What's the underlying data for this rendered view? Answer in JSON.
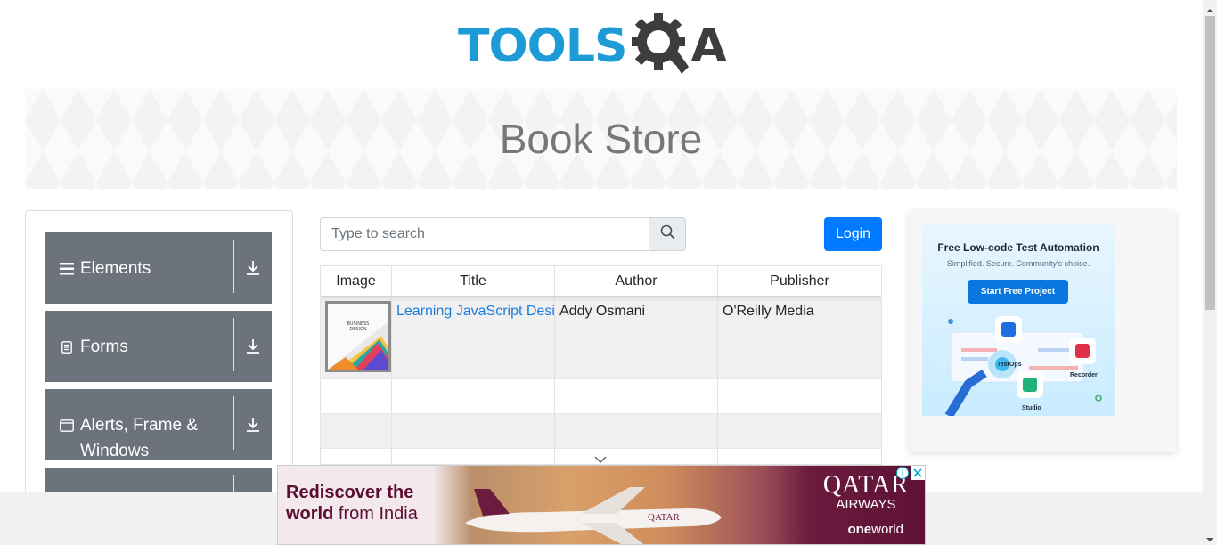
{
  "header": {
    "logo_text": "TOOLS",
    "logo_suffix": "A",
    "logo_color": "#1c9bd7"
  },
  "banner": {
    "title": "Book Store"
  },
  "sidebar": {
    "groups": [
      {
        "label": "Elements",
        "icon": "hamburger-icon"
      },
      {
        "label": "Forms",
        "icon": "document-icon"
      },
      {
        "label": "Alerts, Frame & Windows",
        "icon": "window-icon"
      },
      {
        "label": "",
        "icon": ""
      }
    ]
  },
  "search": {
    "placeholder": "Type to search",
    "value": ""
  },
  "login": {
    "label": "Login",
    "color": "#007bff"
  },
  "table": {
    "columns": [
      "Image",
      "Title",
      "Author",
      "Publisher"
    ],
    "rows": [
      {
        "title": "Learning JavaScript Design Patterns",
        "author": "Addy Osmani",
        "publisher": "O'Reilly Media"
      }
    ]
  },
  "ad_right": {
    "headline": "Free Low-code Test Automation",
    "subline": "Simplified. Secure. Community's choice.",
    "button": "Start Free Project",
    "labels": [
      "TestOps",
      "Recorder",
      "Studio"
    ]
  },
  "ad_bottom": {
    "line1": "Rediscover the",
    "line2_bold": "world",
    "line2_rest": " from India",
    "brand1": "QATAR",
    "brand2": "AIRWAYS",
    "oneworld_bold": "one",
    "oneworld_rest": "world",
    "plane_text": "QATAR"
  }
}
